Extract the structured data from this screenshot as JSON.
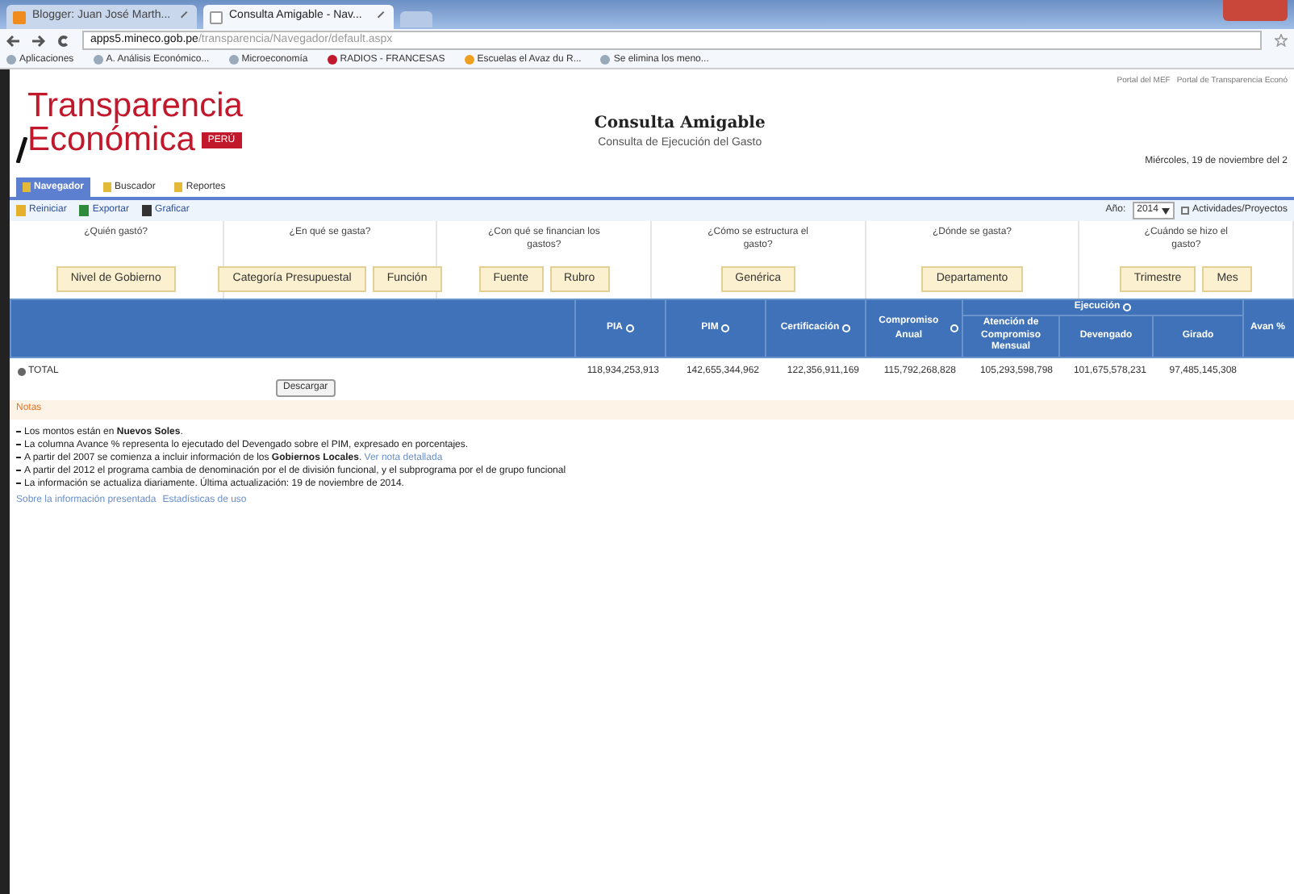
{
  "browser": {
    "tabs": [
      {
        "label": "Blogger: Juan José Marth...",
        "selected": false
      },
      {
        "label": "Consulta Amigable - Nav...",
        "selected": true
      }
    ],
    "url_host": "apps5.mineco.gob.pe",
    "url_path": "/transparencia/Navegador/default.aspx",
    "bookmarks": [
      "Aplicaciones",
      "A. Análisis Económico...",
      "Microeconomía",
      "RADIOS - FRANCESAS",
      "Escuelas el Avaz du R...",
      "Se elimina los meno..."
    ]
  },
  "header": {
    "logo_line1": "Transparencia",
    "logo_line2": "Económica",
    "logo_badge": "PERÚ",
    "title": "Consulta Amigable",
    "subtitle": "Consulta de Ejecución del Gasto",
    "top_links": [
      "Portal del MEF",
      "Portal de Transparencia Econó"
    ],
    "date": "Miércoles, 19 de noviembre del 2"
  },
  "tabs": [
    {
      "label": "Navegador",
      "selected": true
    },
    {
      "label": "Buscador",
      "selected": false
    },
    {
      "label": "Reportes",
      "selected": false
    }
  ],
  "toolbar": [
    "Reiniciar",
    "Exportar",
    "Graficar"
  ],
  "year_label": "Año:",
  "year_value": "2014",
  "view_option": "Actividades/Proyectos",
  "questions": [
    {
      "question": "¿Quién gastó?",
      "buttons": [
        "Nivel de Gobierno"
      ]
    },
    {
      "question": "¿En qué se gasta?",
      "buttons": [
        "Categoría Presupuestal",
        "Función"
      ]
    },
    {
      "question": "¿Con qué se financian los gastos?",
      "buttons": [
        "Fuente",
        "Rubro"
      ]
    },
    {
      "question": "¿Cómo se estructura el gasto?",
      "buttons": [
        "Genérica"
      ]
    },
    {
      "question": "¿Dónde se gasta?",
      "buttons": [
        "Departamento"
      ]
    },
    {
      "question": "¿Cuándo se hizo el gasto?",
      "buttons": [
        "Trimestre",
        "Mes"
      ]
    }
  ],
  "table": {
    "columns": [
      "PIA",
      "PIM",
      "Certificación",
      "Compromiso Anual"
    ],
    "group": "Ejecución",
    "group_columns": [
      "Atención de Compromiso Mensual",
      "Devengado",
      "Girado"
    ],
    "last_column": "Avan %",
    "rows": [
      {
        "label": "TOTAL",
        "values": [
          "118,934,253,913",
          "142,655,344,962",
          "122,356,911,169",
          "115,792,268,828",
          "105,293,598,798",
          "101,675,578,231",
          "97,485,145,308"
        ]
      }
    ],
    "download": "Descargar"
  },
  "notes": {
    "title": "Notas",
    "items": [
      "Los montos están en **Nuevos Soles**.",
      "La columna Avance % representa lo ejecutado del Devengado sobre el PIM, expresado en porcentajes.",
      "A partir del 2007 se comienza a incluir información de los **Gobiernos Locales**."
    ],
    "link": "Ver nota detallada",
    "items2": [
      "A partir del 2012 el programa cambia de denominación por el de división funcional, y el subprograma por el de grupo funcional",
      "La información se actualiza diariamente. Última actualización: 19 de noviembre de 2014."
    ],
    "footer_links": [
      "Sobre la información presentada",
      "Estadísticas de uso"
    ]
  }
}
